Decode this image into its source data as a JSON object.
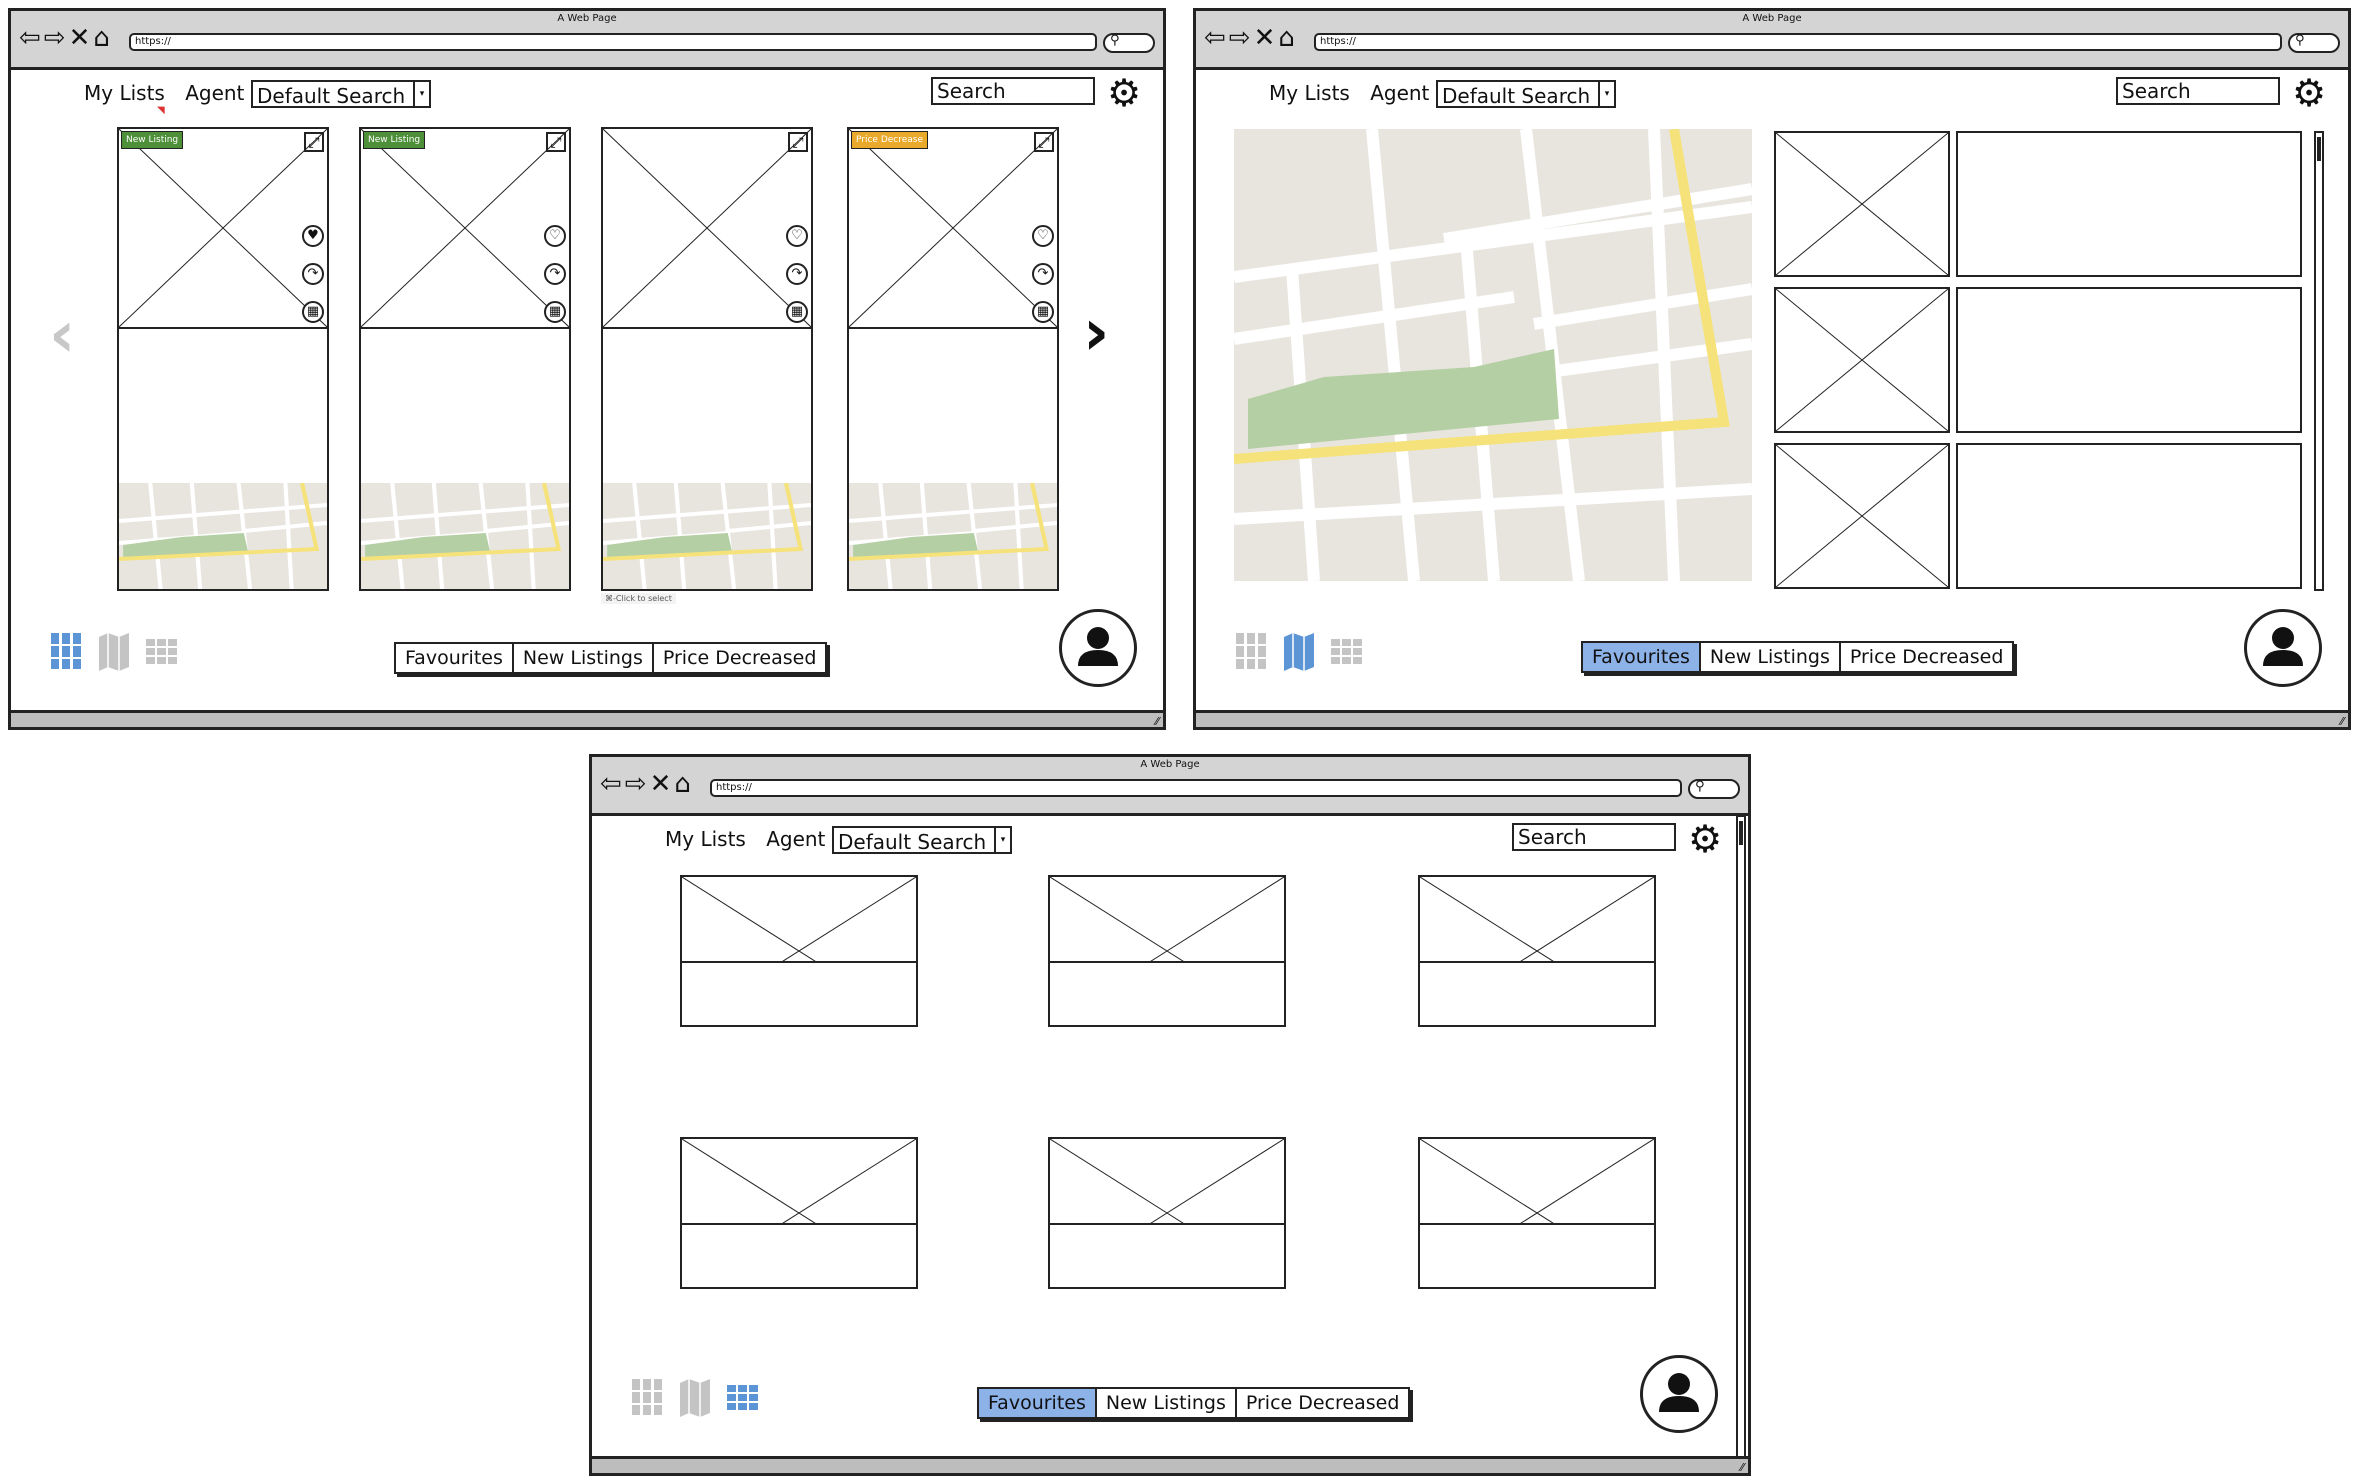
{
  "browser": {
    "window_title": "A Web Page",
    "url": "https://"
  },
  "header": {
    "my_lists": "My Lists",
    "agent": "Agent",
    "search_select": "Default Search",
    "search_placeholder": "Search"
  },
  "filters": {
    "favourites": "Favourites",
    "new_listings": "New Listings",
    "price_decreased": "Price Decreased"
  },
  "window1": {
    "active_view": "columns",
    "active_filter": "none",
    "cards": [
      {
        "badge": "New Listing",
        "badge_color": "#4e8f3a",
        "favourited": true
      },
      {
        "badge": "New Listing",
        "badge_color": "#4e8f3a",
        "favourited": false
      },
      {
        "badge": "",
        "badge_color": "",
        "favourited": false
      },
      {
        "badge": "Price Decrease",
        "badge_color": "#e9a92a",
        "favourited": false
      }
    ],
    "tooltip": "⌘-Click to select"
  },
  "window2": {
    "active_view": "map",
    "active_filter": "favourites"
  },
  "window3": {
    "active_view": "grid",
    "active_filter": "favourites"
  },
  "colors": {
    "active_tab": "#8db2e8",
    "view_active": "#5b95d6",
    "view_inactive": "#c4c4c4",
    "map_park": "#b5cfa4",
    "map_road": "#f6e27a",
    "map_land": "#e8e5df"
  },
  "icons": [
    "back-icon",
    "forward-icon",
    "close-icon",
    "home-icon",
    "gear-icon",
    "expand-icon",
    "heart-icon",
    "share-icon",
    "calendar-icon",
    "chevron-left-icon",
    "chevron-right-icon",
    "columns-view-icon",
    "map-view-icon",
    "grid-view-icon",
    "user-avatar-icon"
  ]
}
